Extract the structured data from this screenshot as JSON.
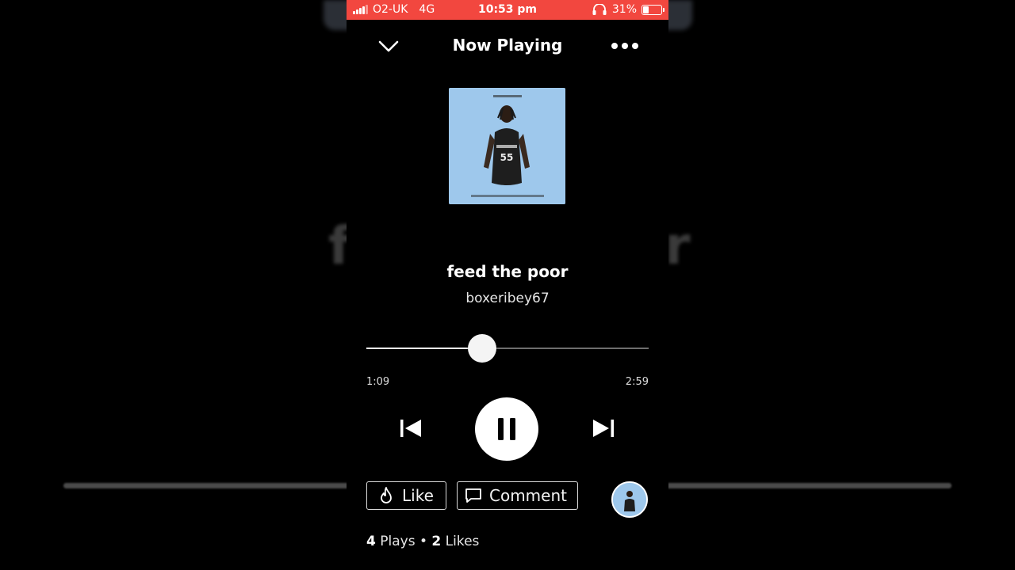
{
  "status_bar": {
    "carrier": "O2-UK",
    "network": "4G",
    "time": "10:53 pm",
    "battery": "31%",
    "battery_level": 0.31,
    "bar_color": "#f2473f"
  },
  "header": {
    "title": "Now Playing",
    "collapse_icon": "chevron-down-icon",
    "more_icon": "more-dots-icon"
  },
  "track": {
    "title": "feed the poor",
    "artist": "boxeribey67",
    "artwork_color": "#9ec8ec"
  },
  "playback": {
    "elapsed": "1:09",
    "total": "2:59",
    "progress_fraction": 0.41,
    "state": "playing"
  },
  "controls": {
    "prev_icon": "skip-back-icon",
    "play_icon": "pause-icon",
    "next_icon": "skip-forward-icon"
  },
  "actions": {
    "like_label": "Like",
    "comment_label": "Comment",
    "like_icon": "flame-icon",
    "comment_icon": "comment-icon"
  },
  "stats": {
    "plays_count": "4",
    "plays_label": "Plays",
    "separator": "•",
    "likes_count": "2",
    "likes_label": "Likes"
  },
  "background": {
    "title_left": "f",
    "title_right": "r"
  }
}
